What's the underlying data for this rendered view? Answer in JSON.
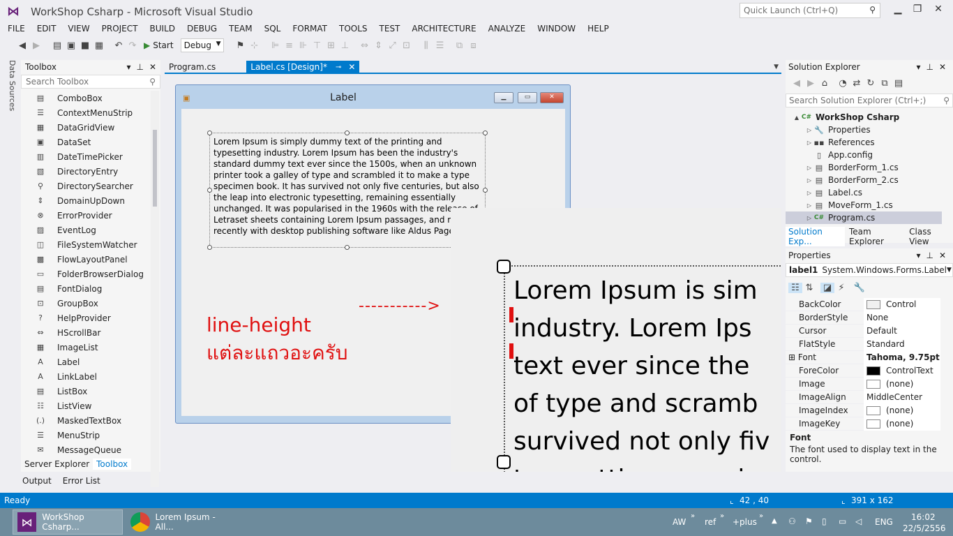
{
  "window": {
    "title": "WorkShop Csharp - Microsoft Visual Studio",
    "quick_launch_placeholder": "Quick Launch (Ctrl+Q)"
  },
  "menu": [
    "FILE",
    "EDIT",
    "VIEW",
    "PROJECT",
    "BUILD",
    "DEBUG",
    "TEAM",
    "SQL",
    "FORMAT",
    "TOOLS",
    "TEST",
    "ARCHITECTURE",
    "ANALYZE",
    "WINDOW",
    "HELP"
  ],
  "toolbar": {
    "start_label": "Start",
    "config": "Debug"
  },
  "side_tab": "Data Sources",
  "toolbox": {
    "title": "Toolbox",
    "search_placeholder": "Search Toolbox",
    "items": [
      {
        "label": "ComboBox",
        "icon": "combobox-icon"
      },
      {
        "label": "ContextMenuStrip",
        "icon": "contextmenu-icon"
      },
      {
        "label": "DataGridView",
        "icon": "datagrid-icon"
      },
      {
        "label": "DataSet",
        "icon": "dataset-icon"
      },
      {
        "label": "DateTimePicker",
        "icon": "datetimepicker-icon"
      },
      {
        "label": "DirectoryEntry",
        "icon": "directoryentry-icon"
      },
      {
        "label": "DirectorySearcher",
        "icon": "directorysearcher-icon"
      },
      {
        "label": "DomainUpDown",
        "icon": "domainupdown-icon"
      },
      {
        "label": "ErrorProvider",
        "icon": "errorprovider-icon"
      },
      {
        "label": "EventLog",
        "icon": "eventlog-icon"
      },
      {
        "label": "FileSystemWatcher",
        "icon": "filesystemwatcher-icon"
      },
      {
        "label": "FlowLayoutPanel",
        "icon": "flowlayout-icon"
      },
      {
        "label": "FolderBrowserDialog",
        "icon": "folderbrowser-icon"
      },
      {
        "label": "FontDialog",
        "icon": "fontdialog-icon"
      },
      {
        "label": "GroupBox",
        "icon": "groupbox-icon"
      },
      {
        "label": "HelpProvider",
        "icon": "helpprovider-icon"
      },
      {
        "label": "HScrollBar",
        "icon": "hscrollbar-icon"
      },
      {
        "label": "ImageList",
        "icon": "imagelist-icon"
      },
      {
        "label": "Label",
        "icon": "label-icon"
      },
      {
        "label": "LinkLabel",
        "icon": "linklabel-icon"
      },
      {
        "label": "ListBox",
        "icon": "listbox-icon"
      },
      {
        "label": "ListView",
        "icon": "listview-icon"
      },
      {
        "label": "MaskedTextBox",
        "icon": "maskedtextbox-icon"
      },
      {
        "label": "MenuStrip",
        "icon": "menustrip-icon"
      },
      {
        "label": "MessageQueue",
        "icon": "messagequeue-icon"
      }
    ],
    "tabs": [
      "Server Explorer",
      "Toolbox"
    ],
    "bottom_tabs": [
      "Output",
      "Error List"
    ]
  },
  "doc_tabs": [
    {
      "label": "Program.cs",
      "active": false
    },
    {
      "label": "Label.cs [Design]*",
      "active": true
    }
  ],
  "form": {
    "title": "Label",
    "label_text": "Lorem Ipsum is simply dummy text of the printing and typesetting industry. Lorem Ipsum has been the industry's standard dummy text ever since the 1500s, when an unknown printer took a galley of type and scrambled it to make a type specimen book. It has survived not only five centuries, but also the leap into electronic typesetting, remaining essentially unchanged. It was popularised in the 1960s with the release of Letraset sheets containing Lorem Ipsum passages, and more recently with desktop publishing software like Aldus PageMaker including versions of Lorem Ipsum."
  },
  "zoom": {
    "lines": [
      "Lorem Ipsum is sim",
      "industry. Lorem Ips",
      "text ever since the",
      "of type and scramb",
      "survived not only fiv",
      "typesetting, remain"
    ]
  },
  "annotation": {
    "line1": "line-height",
    "line2": "แต่ละแถวอะครับ",
    "arrow": "----------->"
  },
  "solution_explorer": {
    "title": "Solution Explorer",
    "search_placeholder": "Search Solution Explorer (Ctrl+;)",
    "items": [
      {
        "label": "WorkShop Csharp",
        "level": 0,
        "icon": "project-icon",
        "expander": "▲",
        "bold": true
      },
      {
        "label": "Properties",
        "level": 1,
        "icon": "properties-icon",
        "expander": "▷"
      },
      {
        "label": "References",
        "level": 1,
        "icon": "references-icon",
        "expander": "▷"
      },
      {
        "label": "App.config",
        "level": 1,
        "icon": "config-icon",
        "expander": ""
      },
      {
        "label": "BorderForm_1.cs",
        "level": 1,
        "icon": "form-icon",
        "expander": "▷"
      },
      {
        "label": "BorderForm_2.cs",
        "level": 1,
        "icon": "form-icon",
        "expander": "▷"
      },
      {
        "label": "Label.cs",
        "level": 1,
        "icon": "form-icon",
        "expander": "▷"
      },
      {
        "label": "MoveForm_1.cs",
        "level": 1,
        "icon": "form-icon",
        "expander": "▷"
      },
      {
        "label": "Program.cs",
        "level": 1,
        "icon": "csharp-icon",
        "expander": "▷",
        "selected": true
      }
    ],
    "tabs": [
      "Solution Exp...",
      "Team Explorer",
      "Class View"
    ]
  },
  "properties": {
    "title": "Properties",
    "object_name": "label1",
    "object_type": "System.Windows.Forms.Label",
    "rows": [
      {
        "name": "BackColor",
        "value": "Control",
        "swatch": "#f0f0f0"
      },
      {
        "name": "BorderStyle",
        "value": "None"
      },
      {
        "name": "Cursor",
        "value": "Default"
      },
      {
        "name": "FlatStyle",
        "value": "Standard"
      },
      {
        "name": "Font",
        "value": "Tahoma, 9.75pt",
        "bold": true,
        "expandable": true
      },
      {
        "name": "ForeColor",
        "value": "ControlText",
        "swatch": "#000000"
      },
      {
        "name": "Image",
        "value": "(none)",
        "swatch": "#ffffff"
      },
      {
        "name": "ImageAlign",
        "value": "MiddleCenter"
      },
      {
        "name": "ImageIndex",
        "value": "(none)",
        "swatch": "#ffffff"
      },
      {
        "name": "ImageKey",
        "value": "(none)",
        "swatch": "#ffffff"
      }
    ],
    "desc_title": "Font",
    "desc_text": "The font used to display text in the control."
  },
  "status": {
    "text": "Ready",
    "position": "42 , 40",
    "size": "391 x 162"
  },
  "taskbar": {
    "tasks": [
      {
        "label": "WorkShop Csharp...",
        "icon": "visual-studio-icon"
      },
      {
        "label": "Lorem Ipsum - All...",
        "icon": "chrome-icon"
      }
    ],
    "toolbars": [
      "AW",
      "ref",
      "+plus"
    ],
    "lang": "ENG",
    "time": "16:02",
    "date": "22/5/2556"
  },
  "colors": {
    "accent": "#007acc",
    "vs_purple": "#68217a",
    "annotation_red": "#e01010"
  }
}
